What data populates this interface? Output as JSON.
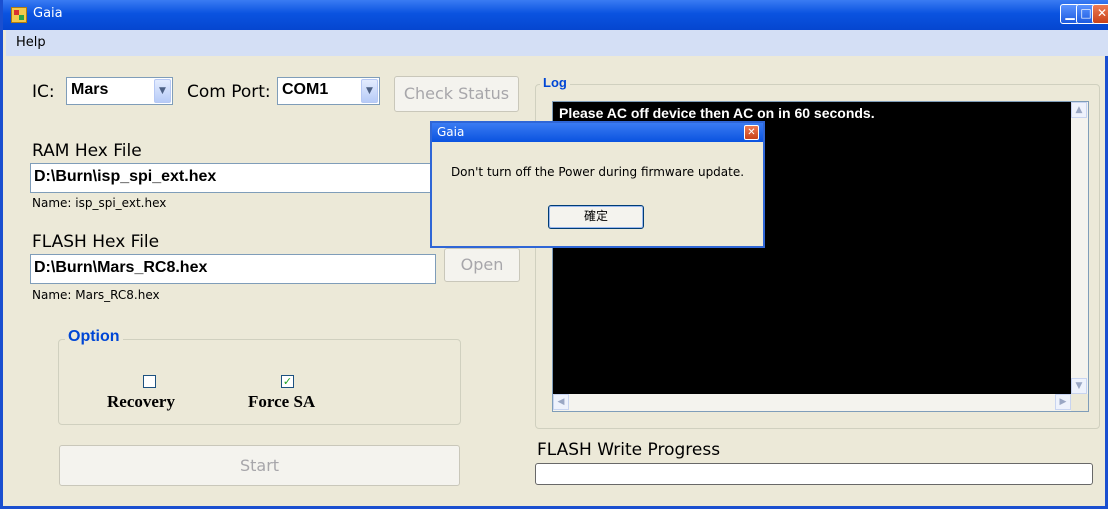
{
  "window": {
    "title": "Gaia"
  },
  "menu": {
    "help": "Help"
  },
  "ic": {
    "label": "IC:",
    "value": "Mars"
  },
  "com_port": {
    "label": "Com Port:",
    "value": "COM1"
  },
  "check_status_button": "Check Status",
  "ram": {
    "label": "RAM Hex File",
    "path": "D:\\Burn\\isp_spi_ext.hex",
    "name": "Name: isp_spi_ext.hex"
  },
  "flash": {
    "label": "FLASH Hex File",
    "path": "D:\\Burn\\Mars_RC8.hex",
    "name": "Name: Mars_RC8.hex",
    "open_button": "Open"
  },
  "option": {
    "legend": "Option",
    "recovery_label": "Recovery",
    "recovery_checked": false,
    "force_sa_label": "Force SA",
    "force_sa_checked": true
  },
  "start_button": "Start",
  "log": {
    "legend": "Log",
    "text": "Please AC off device then AC on in 60 seconds."
  },
  "flash_progress": {
    "label": "FLASH Write Progress",
    "value": 0
  },
  "dialog": {
    "title": "Gaia",
    "message": "Don't turn off the Power during firmware update.",
    "ok_button": "確定"
  },
  "colors": {
    "titlebar": "#0a53e0",
    "legend": "#0046d5",
    "background": "#ece9d8"
  }
}
